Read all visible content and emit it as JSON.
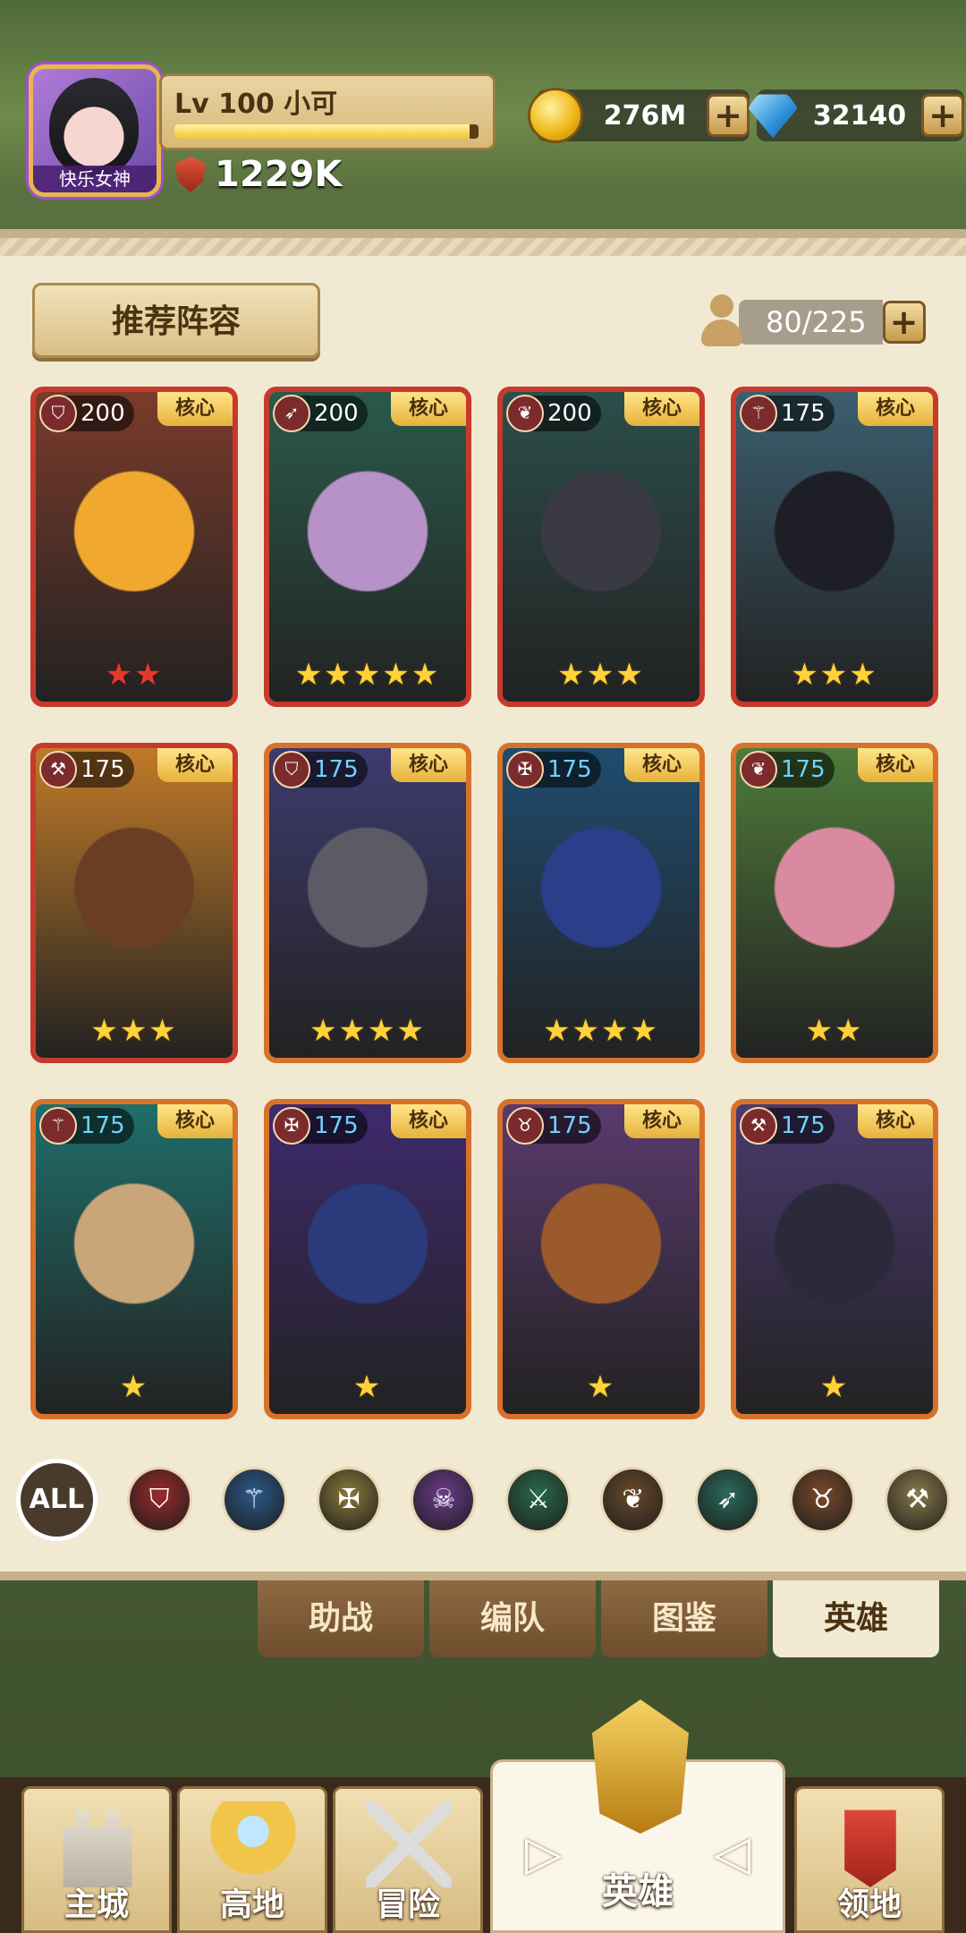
{
  "player": {
    "avatar_tag": "快乐女神",
    "level": "Lv 100",
    "name": "小可",
    "level_name": "Lv 100 小可",
    "power": "1229K",
    "exp_progress": 0.97
  },
  "currency": {
    "gold": "276M",
    "gems": "32140"
  },
  "panel": {
    "recommend_label": "推荐阵容",
    "capacity": "80/225"
  },
  "heroes": [
    {
      "level": "200",
      "badge": "核心",
      "stars": 2,
      "star_color": "red",
      "border": "red",
      "class_icon": "shield-icon",
      "art": [
        "#7a3b2b",
        "#f0a92e"
      ]
    },
    {
      "level": "200",
      "badge": "核心",
      "stars": 5,
      "star_color": "yellow",
      "border": "red",
      "class_icon": "bow-icon",
      "art": [
        "#2a5a4a",
        "#b792c9"
      ]
    },
    {
      "level": "200",
      "badge": "核心",
      "stars": 3,
      "star_color": "yellow",
      "border": "red",
      "class_icon": "paw-icon",
      "art": [
        "#2b4e4a",
        "#3a3a44"
      ]
    },
    {
      "level": "175",
      "badge": "核心",
      "stars": 3,
      "star_color": "yellow",
      "border": "red",
      "class_icon": "staff-icon",
      "art": [
        "#3b5e6e",
        "#1e1e26"
      ]
    },
    {
      "level": "175",
      "badge": "核心",
      "stars": 3,
      "star_color": "yellow",
      "border": "red",
      "class_icon": "axe-icon",
      "art": [
        "#c07a28",
        "#6a3e24"
      ]
    },
    {
      "level": "175",
      "badge": "核心",
      "stars": 4,
      "star_color": "yellow",
      "border": "orange",
      "class_icon": "shield-icon",
      "art": [
        "#3e3a6e",
        "#5b5b66"
      ]
    },
    {
      "level": "175",
      "badge": "核心",
      "stars": 4,
      "star_color": "yellow",
      "border": "orange",
      "class_icon": "crest-icon",
      "art": [
        "#1f4c6e",
        "#2a3e8a"
      ]
    },
    {
      "level": "175",
      "badge": "核心",
      "stars": 2,
      "star_color": "yellow",
      "border": "orange",
      "class_icon": "paw-icon",
      "art": [
        "#4e7a3a",
        "#d98aa0"
      ]
    },
    {
      "level": "175",
      "badge": "核心",
      "stars": 1,
      "star_color": "yellow",
      "border": "orange",
      "class_icon": "staff-icon",
      "art": [
        "#1f6e6a",
        "#c9a67a"
      ]
    },
    {
      "level": "175",
      "badge": "核心",
      "stars": 1,
      "star_color": "yellow",
      "border": "orange",
      "class_icon": "crest-icon",
      "art": [
        "#3e2a6e",
        "#2a3a7a"
      ]
    },
    {
      "level": "175",
      "badge": "核心",
      "stars": 1,
      "star_color": "yellow",
      "border": "orange",
      "class_icon": "bull-icon",
      "art": [
        "#5a3a6e",
        "#9b5a2b"
      ]
    },
    {
      "level": "175",
      "badge": "核心",
      "stars": 1,
      "star_color": "yellow",
      "border": "orange",
      "class_icon": "axe-icon",
      "art": [
        "#4a3a6e",
        "#2a2a3a"
      ]
    }
  ],
  "filters": {
    "all_label": "ALL",
    "icons": [
      {
        "name": "shield-icon",
        "color": "#9b2a2a",
        "glyph": "⛉"
      },
      {
        "name": "staff-icon",
        "color": "#2a5a8a",
        "glyph": "⚚"
      },
      {
        "name": "crest-icon",
        "color": "#8a7a3a",
        "glyph": "✠"
      },
      {
        "name": "skull-icon",
        "color": "#6a3a8a",
        "glyph": "☠"
      },
      {
        "name": "daggers-icon",
        "color": "#2a6a4a",
        "glyph": "⚔"
      },
      {
        "name": "paw-icon",
        "color": "#6a4a2a",
        "glyph": "❦"
      },
      {
        "name": "bow-icon",
        "color": "#2a6a5a",
        "glyph": "➶"
      },
      {
        "name": "bull-icon",
        "color": "#7a4a2a",
        "glyph": "♉"
      },
      {
        "name": "axe-icon",
        "color": "#8a7a4a",
        "glyph": "⚒"
      }
    ]
  },
  "subtabs": [
    "助战",
    "编队",
    "图鉴",
    "英雄"
  ],
  "nav": {
    "items": [
      "主城",
      "高地",
      "冒险"
    ],
    "active": "英雄",
    "last": "领地"
  }
}
